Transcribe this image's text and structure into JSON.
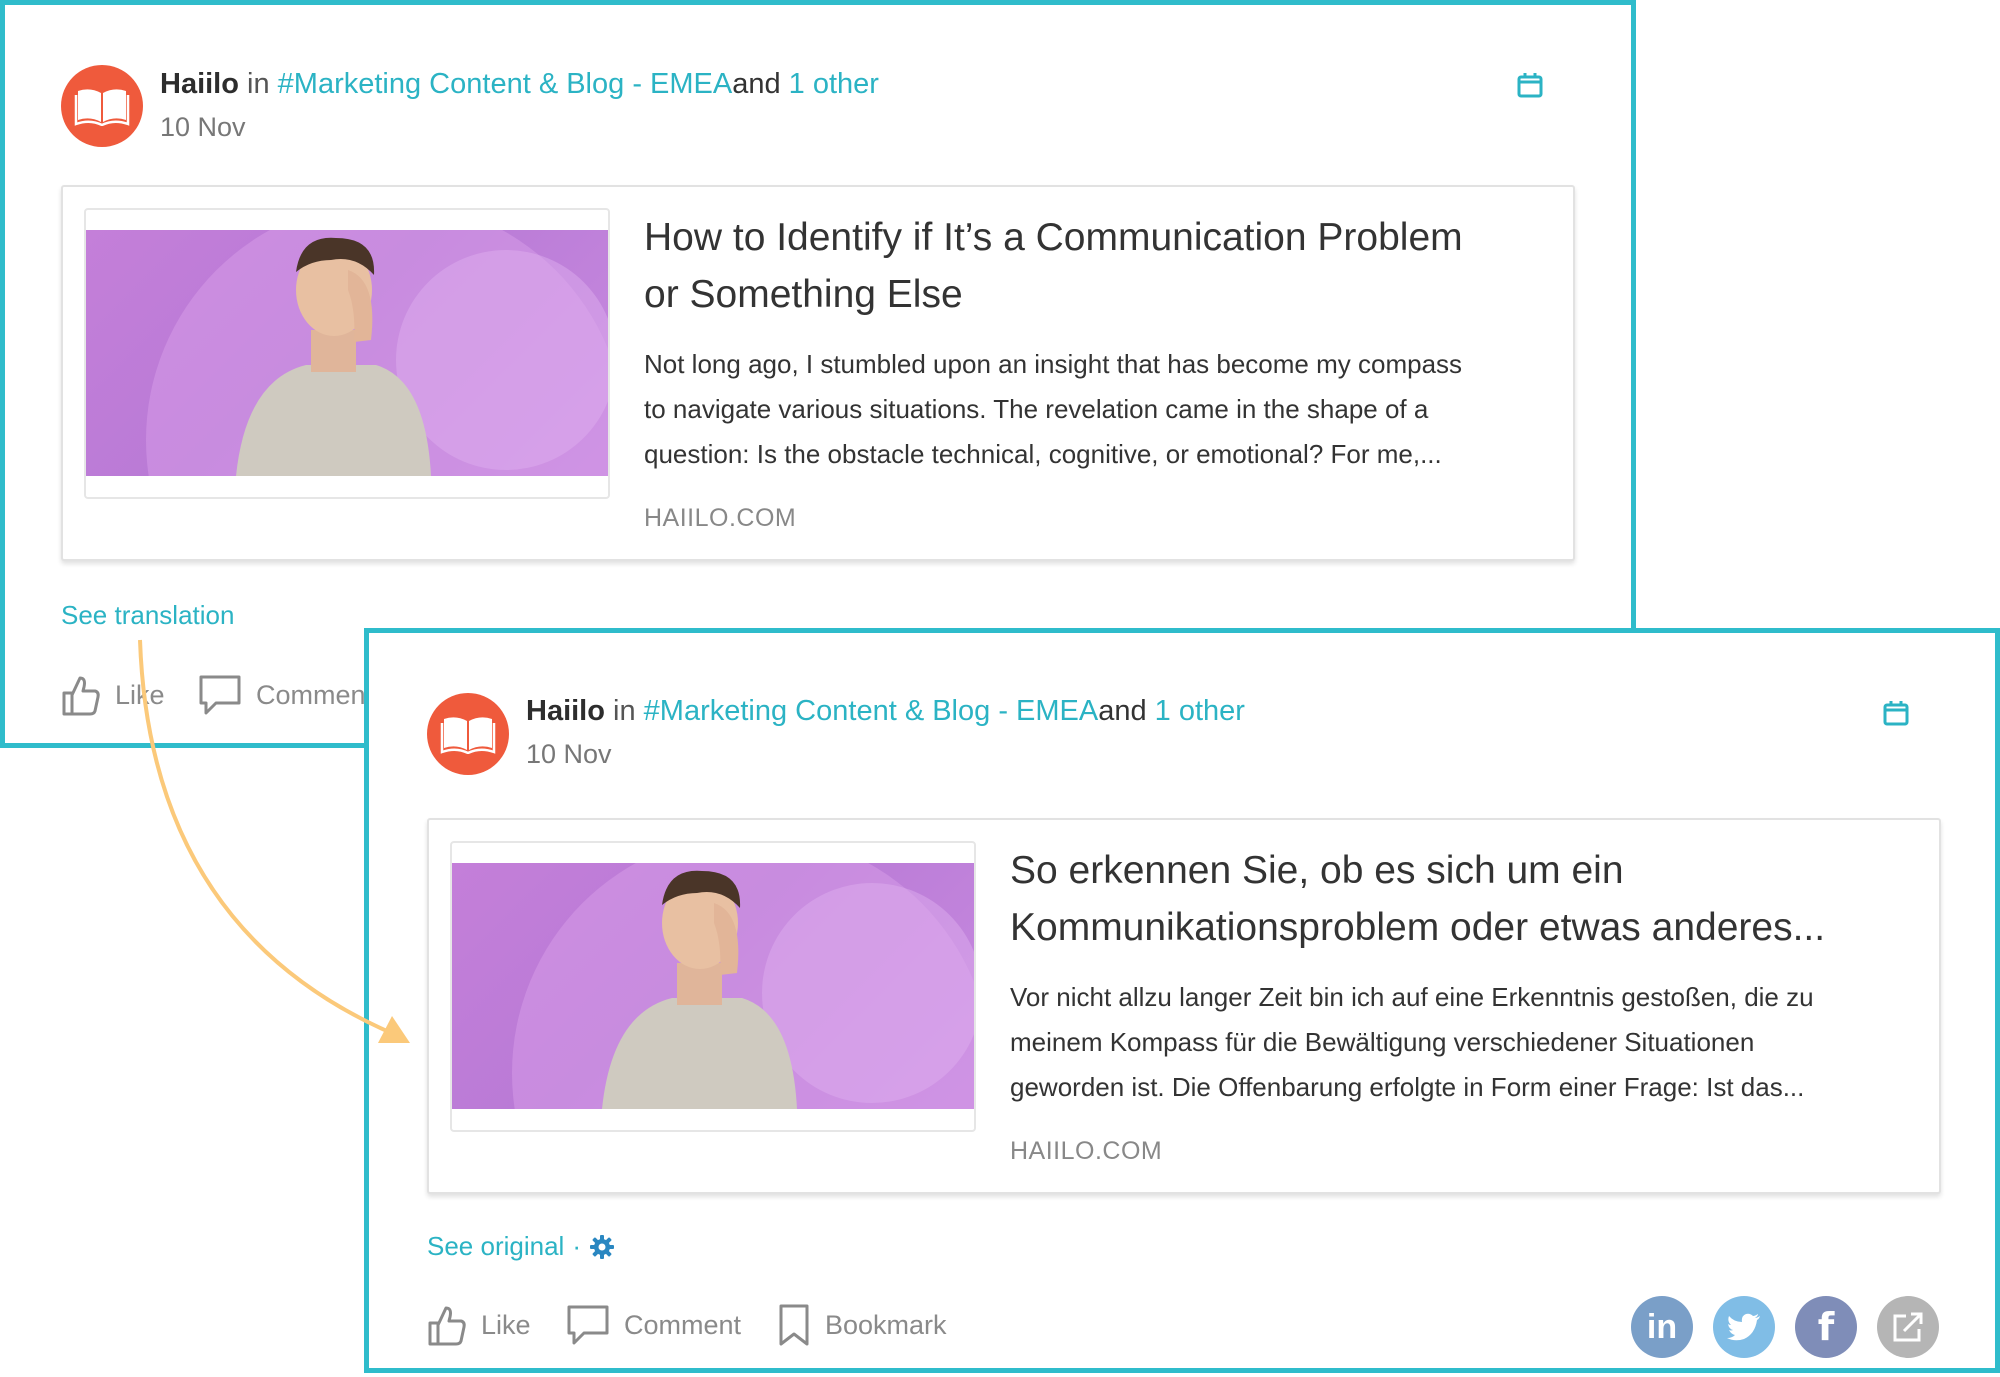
{
  "original_post": {
    "author": "Haiilo",
    "in_word": "in",
    "channel": "#Marketing Content & Blog - EMEA",
    "and_word": "and",
    "others_link": "1 other",
    "date": "10 Nov",
    "article": {
      "title_line1": "How to Identify if It’s a Communication Problem",
      "title_line2": "or Something Else",
      "excerpt_line1": "Not long ago, I stumbled upon an insight that has become my compass",
      "excerpt_line2": "to navigate various situations. The revelation came in the shape of a",
      "excerpt_line3": "question: Is the obstacle technical, cognitive, or emotional? For me,...",
      "source": "HAIILO.COM"
    },
    "see_translation": "See translation",
    "actions": {
      "like": "Like",
      "comment": "Comment"
    }
  },
  "translated_post": {
    "author": "Haiilo",
    "in_word": "in",
    "channel": "#Marketing Content & Blog - EMEA",
    "and_word": "and",
    "others_link": "1 other",
    "date": "10 Nov",
    "article": {
      "title_line1": "So erkennen Sie, ob es sich um ein",
      "title_line2": "Kommunikationsproblem oder etwas anderes...",
      "excerpt_line1": "Vor nicht allzu langer Zeit bin ich auf eine Erkenntnis gestoßen, die zu",
      "excerpt_line2": "meinem Kompass für die Bewältigung verschiedener Situationen",
      "excerpt_line3": "geworden ist. Die Offenbarung erfolgte in Form einer Frage: Ist das...",
      "source": "HAIILO.COM"
    },
    "see_original": "See original",
    "separator": "·",
    "actions": {
      "like": "Like",
      "comment": "Comment",
      "bookmark": "Bookmark"
    },
    "share_icons": [
      "linkedin-icon",
      "twitter-icon",
      "facebook-icon",
      "external-share-icon"
    ]
  },
  "colors": {
    "accent": "#2bb3c4",
    "frame": "#2fbccb",
    "avatar": "#ef5a3c",
    "arrow": "#fbc97a",
    "linkedin": "#7a9fc8",
    "twitter": "#80bde6",
    "facebook": "#7f8db8",
    "share": "#b5b5b5"
  }
}
